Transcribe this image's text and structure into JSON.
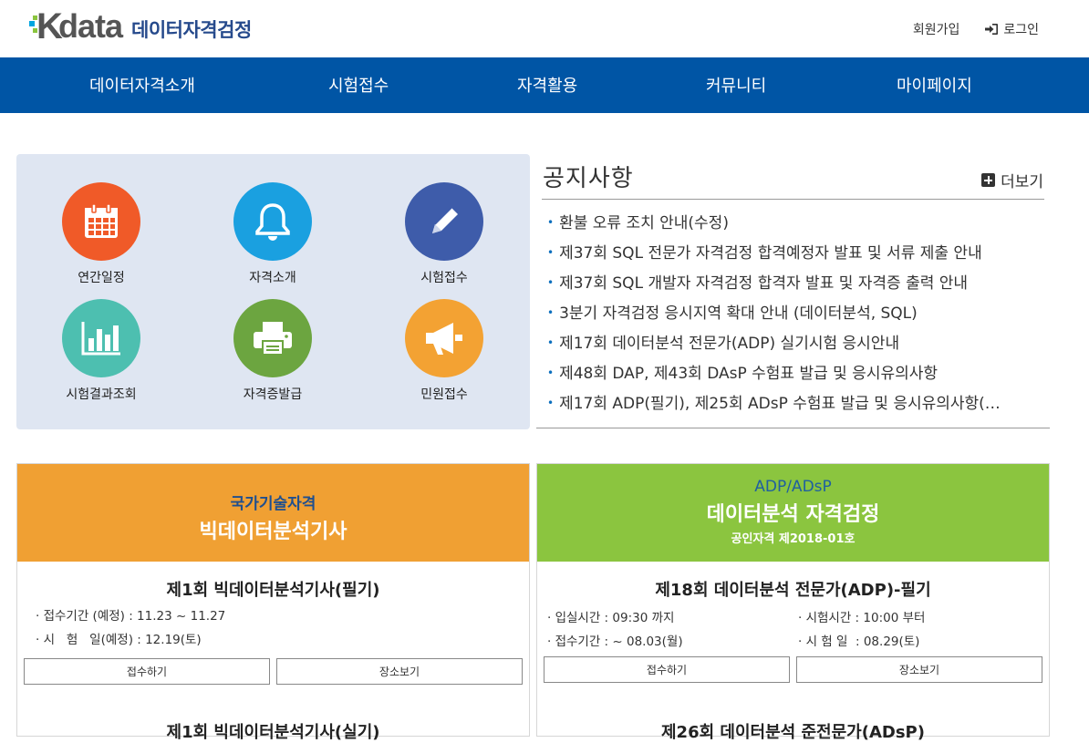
{
  "header": {
    "logo_text": "data",
    "logo_k": "K",
    "logo_sub": "데이터자격검정",
    "signup": "회원가입",
    "login": "로그인"
  },
  "nav": [
    "데이터자격소개",
    "시험접수",
    "자격활용",
    "커뮤니티",
    "마이페이지"
  ],
  "quick": [
    {
      "label": "연간일정",
      "icon": "calendar-icon",
      "color": "#f05a28"
    },
    {
      "label": "자격소개",
      "icon": "bell-icon",
      "color": "#1aa0e0"
    },
    {
      "label": "시험접수",
      "icon": "pencil-icon",
      "color": "#3e5caa"
    },
    {
      "label": "시험결과조회",
      "icon": "bar-chart-icon",
      "color": "#4dbfb0"
    },
    {
      "label": "자격증발급",
      "icon": "printer-icon",
      "color": "#6ca540"
    },
    {
      "label": "민원접수",
      "icon": "megaphone-icon",
      "color": "#f3a233"
    }
  ],
  "notice": {
    "title": "공지사항",
    "more": "더보기",
    "items": [
      "환불 오류 조치 안내(수정)",
      "제37회 SQL 전문가 자격검정 합격예정자 발표 및 서류 제출 안내",
      "제37회 SQL 개발자 자격검정 합격자 발표 및 자격증 출력 안내",
      "3분기 자격검정 응시지역 확대 안내 (데이터분석, SQL)",
      "제17회 데이터분석 전문가(ADP) 실기시험 응시안내",
      "제48회 DAP, 제43회 DAsP 수험표 발급 및 응시유의사항",
      "제17회 ADP(필기), 제25회 ADsP 수험표 발급 및 응시유의사항(…"
    ]
  },
  "card1": {
    "color": "#f0a033",
    "subtitle": "국가기술자격",
    "title": "빅데이터분석기사",
    "exam_title": "제1회 빅데이터분석기사(필기)",
    "info1": "· 접수기간 (예정) : 11.23 ~ 11.27",
    "info2": "· 시   험   일(예정) : 12.19(토)",
    "btn_apply": "접수하기",
    "btn_place": "장소보기",
    "next_title": "제1회 빅데이터분석기사(실기)"
  },
  "card2": {
    "color": "#8bc53f",
    "subtitle": "ADP/ADsP",
    "title": "데이터분석 자격검정",
    "small": "공인자격 제2018-01호",
    "exam_title": "제18회 데이터분석 전문가(ADP)-필기",
    "info1": "· 입실시간 : 09:30 까지",
    "info2": "· 접수기간 : ~ 08.03(월)",
    "info3": "· 시험시간 : 10:00 부터",
    "info4": "· 시 험 일  : 08.29(토)",
    "btn_apply": "접수하기",
    "btn_place": "장소보기",
    "next_title": "제26회 데이터분석 준전문가(ADsP)"
  }
}
